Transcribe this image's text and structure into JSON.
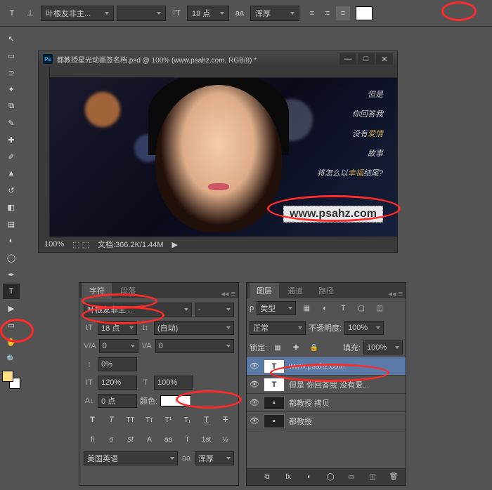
{
  "topbar": {
    "font": "叶根友非主...",
    "sizeLabel": "18 点",
    "aa": "浑厚"
  },
  "doc": {
    "title": "都教授星光动画签名档.psd @ 100% (www.psahz.com, RGB/8) *",
    "zoom": "100%",
    "fileinfo": "文档:366.2K/1.44M"
  },
  "canvasText": {
    "l1": "但是",
    "l2": "你回答我",
    "l3": "没有",
    "l3b": "爱情",
    "l4": "故事",
    "l5a": "将怎么以",
    "l5b": "幸福",
    "l5c": "结尾?",
    "url": "www.psahz.com"
  },
  "char": {
    "tab1": "字符",
    "tab2": "段落",
    "font": "叶根友非主...",
    "style": "-",
    "size": "18 点",
    "leading": "(自动)",
    "va": "0",
    "vaNum": "0",
    "scale": "0%",
    "height": "120%",
    "width": "100%",
    "baseline": "0 点",
    "colorLabel": "颜色:",
    "lang": "美国英语",
    "aa": "浑厚"
  },
  "layer": {
    "tab1": "图层",
    "tab2": "通道",
    "tab3": "路径",
    "kind": "类型",
    "blend": "正常",
    "opLabel": "不透明度:",
    "op": "100%",
    "lockLabel": "锁定:",
    "fillLabel": "填充:",
    "fill": "100%",
    "l1": "www.psahz.com",
    "l2": "但是 你回答我 没有爱...",
    "l3": "都教授 拷贝",
    "l4": "都教授"
  }
}
